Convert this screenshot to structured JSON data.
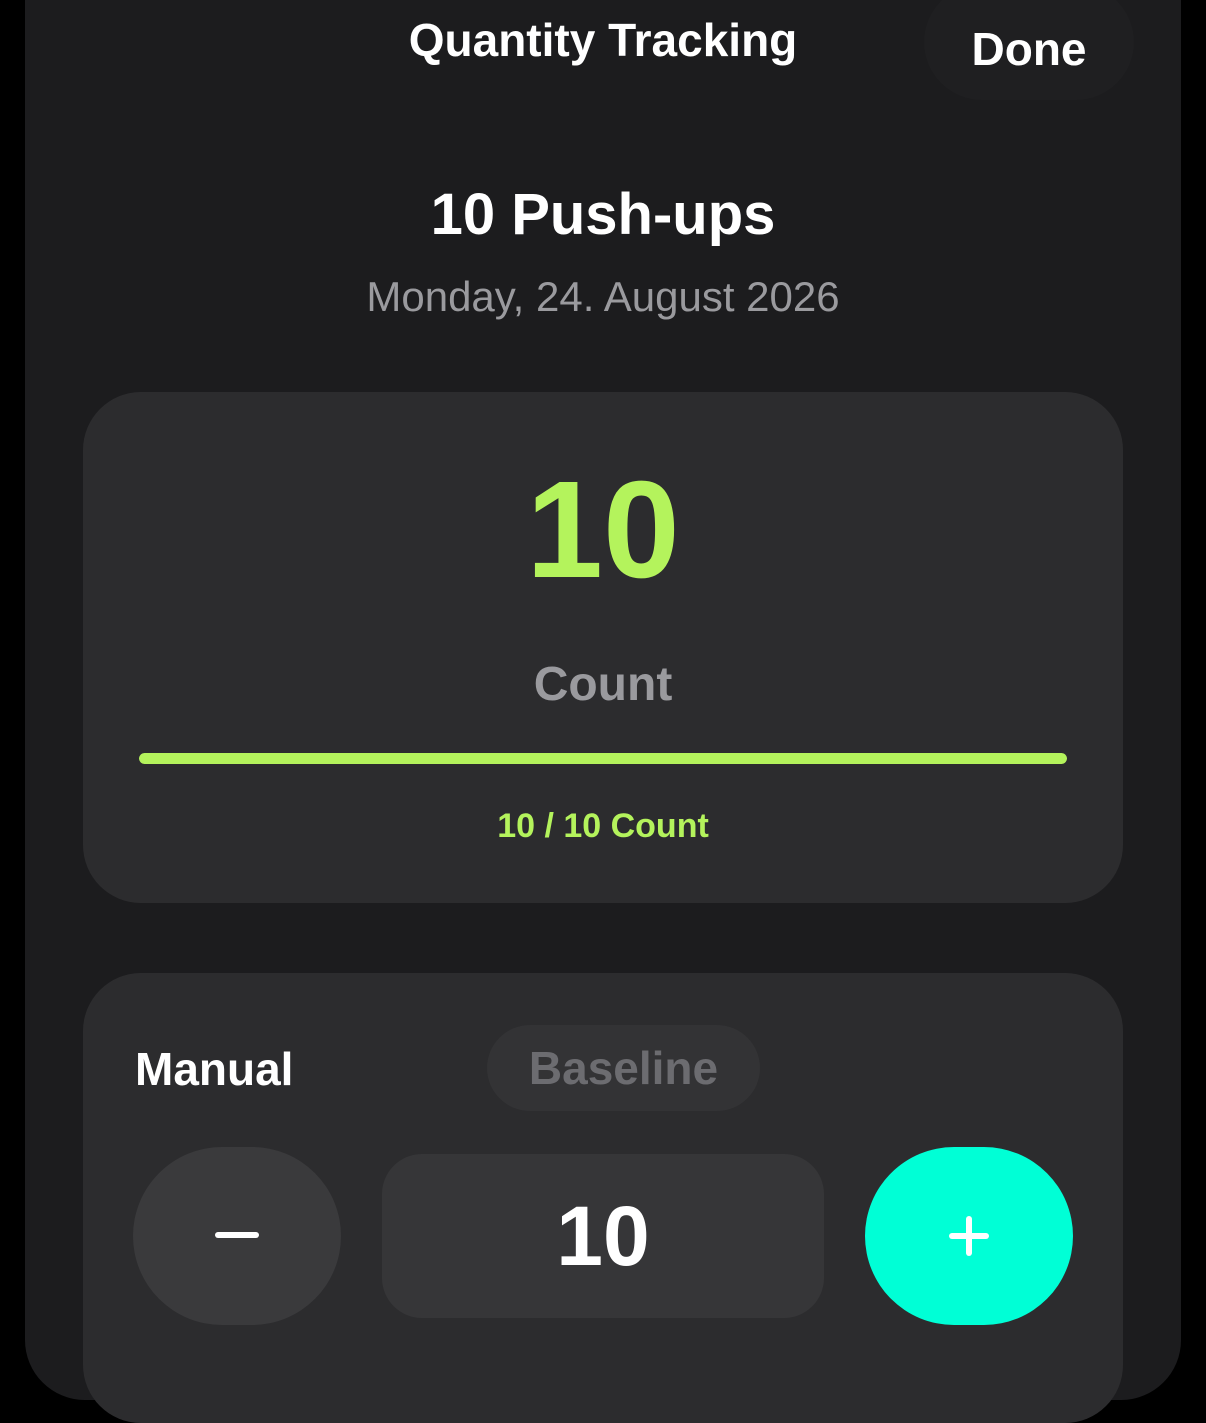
{
  "header": {
    "title": "Quantity Tracking",
    "done_label": "Done"
  },
  "habit": {
    "name": "10 Push-ups",
    "date": "Monday, 24. August 2026"
  },
  "progress": {
    "value": "10",
    "unit": "Count",
    "summary": "10 / 10 Count",
    "fraction": 1.0
  },
  "input": {
    "mode_manual": "Manual",
    "mode_baseline": "Baseline",
    "value": "10"
  },
  "icons": {
    "decrement": "minus-icon",
    "increment": "plus-icon"
  },
  "colors": {
    "accent_green": "#b4f35c",
    "accent_teal": "#00ffd6",
    "background": "#1c1c1e",
    "card": "#2c2c2e"
  }
}
